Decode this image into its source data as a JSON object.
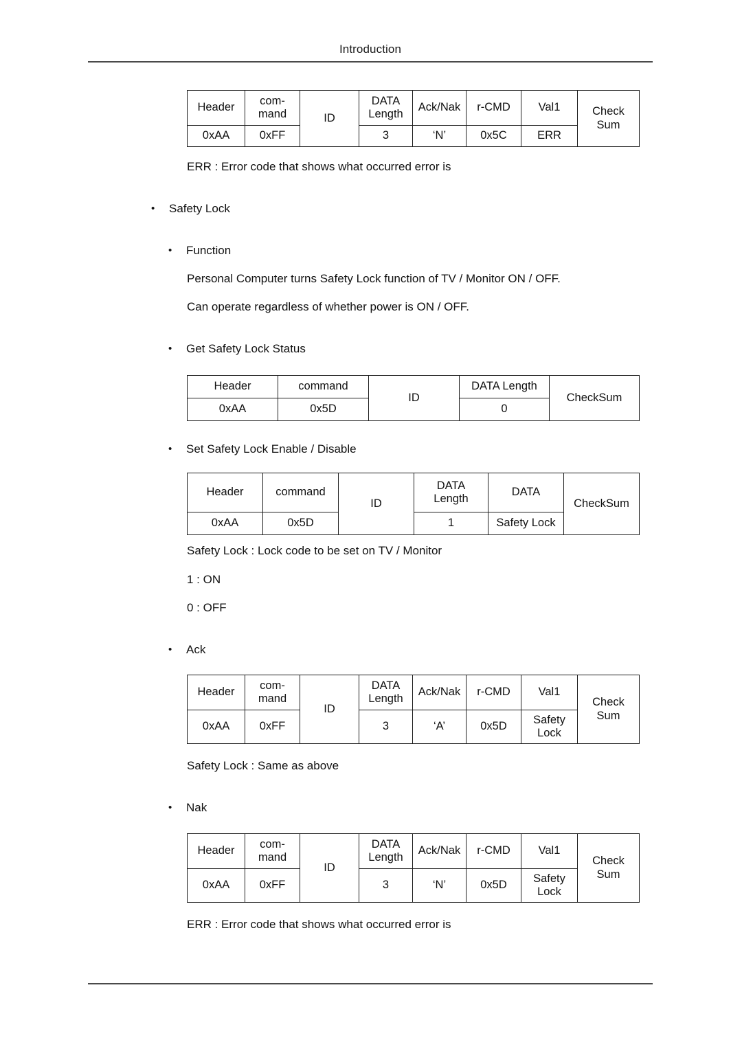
{
  "document": {
    "running_head": "Introduction"
  },
  "sections": [
    {
      "id": "nak-top-table",
      "type": "packet-table",
      "columns": [
        "Header",
        "com-mand",
        "ID",
        "DATA Length",
        "Ack/Nak",
        "r-CMD",
        "Val1",
        "Check Sum"
      ],
      "header_cells": [
        {
          "text": "Header",
          "rowspan": 1
        },
        {
          "text": "com-\nmand",
          "rowspan": 1
        },
        {
          "text": "ID",
          "rowspan": 2
        },
        {
          "text": "DATA\nLength",
          "rowspan": 1
        },
        {
          "text": "Ack/Nak",
          "rowspan": 1
        },
        {
          "text": "r-CMD",
          "rowspan": 1
        },
        {
          "text": "Val1",
          "rowspan": 1
        },
        {
          "text": "Check\nSum",
          "rowspan": 2
        }
      ],
      "value_cells": [
        "0xAA",
        "0xFF",
        "3",
        "‘N’",
        "0x5C",
        "ERR"
      ]
    }
  ],
  "table_nak_top": {
    "h_header": "Header",
    "h_command_line1": "com-",
    "h_command_line2": "mand",
    "h_id": "ID",
    "h_datalen_line1": "DATA",
    "h_datalen_line2": "Length",
    "h_acknak": "Ack/Nak",
    "h_rcmd": "r-CMD",
    "h_val1": "Val1",
    "h_check_line1": "Check",
    "h_check_line2": "Sum",
    "v_header": "0xAA",
    "v_command": "0xFF",
    "v_datalen": "3",
    "v_acknak": "‘N’",
    "v_rcmd": "0x5C",
    "v_val1": "ERR"
  },
  "text_err_note_top": "ERR : Error code that shows what occurred error is",
  "bullet_safety_lock": "Safety Lock",
  "bullet_function": "Function",
  "text_function_line1": "Personal Computer turns Safety Lock function of TV / Monitor ON / OFF.",
  "text_function_line2": "Can operate regardless of whether power is ON / OFF.",
  "bullet_get_status": "Get Safety Lock Status",
  "table_get_status": {
    "h_header": "Header",
    "h_command": "command",
    "h_id": "ID",
    "h_datalen": "DATA Length",
    "h_checksum": "CheckSum",
    "v_header": "0xAA",
    "v_command": "0x5D",
    "v_datalen": "0"
  },
  "bullet_set_enable": "Set Safety Lock Enable / Disable",
  "table_set_enable": {
    "h_header": "Header",
    "h_command": "command",
    "h_id": "ID",
    "h_datalen_line1": "DATA",
    "h_datalen_line2": "Length",
    "h_data": "DATA",
    "h_checksum": "CheckSum",
    "v_header": "0xAA",
    "v_command": "0x5D",
    "v_datalen": "1",
    "v_data": "Safety Lock"
  },
  "text_safety_lock_def": "Safety Lock : Lock code to be set on TV / Monitor",
  "text_one_on": "1 : ON",
  "text_zero_off": "0 : OFF",
  "bullet_ack": "Ack",
  "table_ack": {
    "h_header": "Header",
    "h_command_line1": "com-",
    "h_command_line2": "mand",
    "h_id": "ID",
    "h_datalen_line1": "DATA",
    "h_datalen_line2": "Length",
    "h_acknak": "Ack/Nak",
    "h_rcmd": "r-CMD",
    "h_val1": "Val1",
    "h_check_line1": "Check",
    "h_check_line2": "Sum",
    "v_header": "0xAA",
    "v_command": "0xFF",
    "v_datalen": "3",
    "v_acknak": "‘A’",
    "v_rcmd": "0x5D",
    "v_val1_line1": "Safety",
    "v_val1_line2": "Lock"
  },
  "text_safety_same": "Safety Lock : Same as above",
  "bullet_nak": "Nak",
  "table_nak": {
    "h_header": "Header",
    "h_command_line1": "com-",
    "h_command_line2": "mand",
    "h_id": "ID",
    "h_datalen_line1": "DATA",
    "h_datalen_line2": "Length",
    "h_acknak": "Ack/Nak",
    "h_rcmd": "r-CMD",
    "h_val1": "Val1",
    "h_check_line1": "Check",
    "h_check_line2": "Sum",
    "v_header": "0xAA",
    "v_command": "0xFF",
    "v_datalen": "3",
    "v_acknak": "‘N’",
    "v_rcmd": "0x5D",
    "v_val1_line1": "Safety",
    "v_val1_line2": "Lock"
  },
  "text_err_note_bottom": "ERR : Error code that shows what occurred error is",
  "bullet_glyph": "•",
  "colors": {
    "text": "#111111",
    "rule": "#4a4a4a",
    "table_border": "#1d1d1d",
    "background": "#ffffff"
  }
}
